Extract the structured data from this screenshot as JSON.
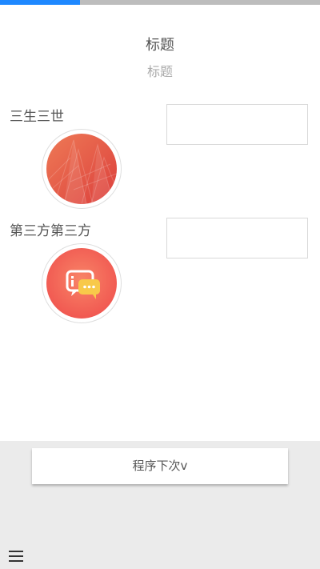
{
  "progress": {
    "fraction": 0.25,
    "fill_color": "#1e88ff",
    "track_color": "#bdbdbd"
  },
  "header": {
    "title": "标题",
    "subtitle": "标题"
  },
  "rows": [
    {
      "label": "三生三世",
      "input_value": "",
      "avatar_icon": "building-photo-icon"
    },
    {
      "label": "第三方第三方",
      "input_value": "",
      "avatar_icon": "chat-bubbles-icon"
    }
  ],
  "footer": {
    "next_button_label": "程序下次v",
    "menu_icon": "hamburger-menu-icon"
  },
  "colors": {
    "avatar_red": "#e8564a",
    "chat_bg": "#f46b5f",
    "chat_yellow": "#f8c94a"
  }
}
